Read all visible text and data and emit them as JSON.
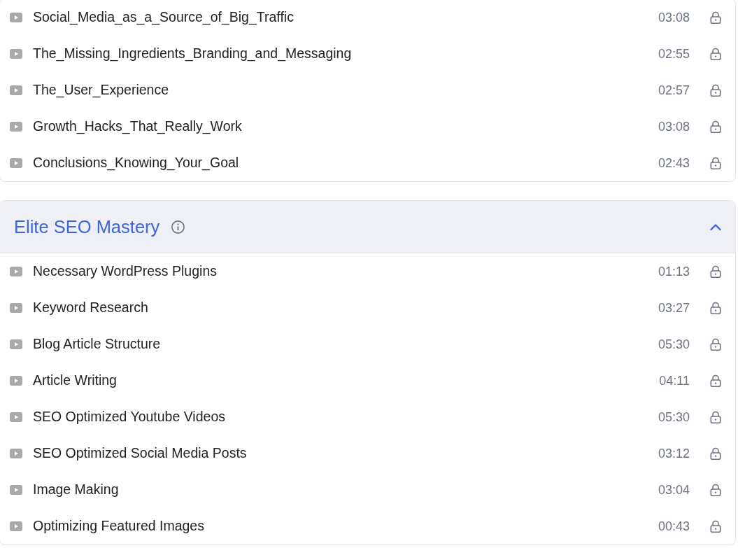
{
  "sections": [
    {
      "lessons": [
        {
          "title": "Social_Media_as_a_Source_of_Big_Traffic",
          "duration": "03:08",
          "locked": true
        },
        {
          "title": "The_Missing_Ingredients_Branding_and_Messaging",
          "duration": "02:55",
          "locked": true
        },
        {
          "title": "The_User_Experience",
          "duration": "02:57",
          "locked": true
        },
        {
          "title": "Growth_Hacks_That_Really_Work",
          "duration": "03:08",
          "locked": true
        },
        {
          "title": "Conclusions_Knowing_Your_Goal",
          "duration": "02:43",
          "locked": true
        }
      ]
    },
    {
      "title": "Elite SEO Mastery",
      "expanded": true,
      "lessons": [
        {
          "title": "Necessary WordPress Plugins",
          "duration": "01:13",
          "locked": true
        },
        {
          "title": "Keyword Research",
          "duration": "03:27",
          "locked": true
        },
        {
          "title": "Blog Article Structure",
          "duration": "05:30",
          "locked": true
        },
        {
          "title": "Article Writing",
          "duration": "04:11",
          "locked": true
        },
        {
          "title": "SEO Optimized Youtube Videos",
          "duration": "05:30",
          "locked": true
        },
        {
          "title": "SEO Optimized Social Media Posts",
          "duration": "03:12",
          "locked": true
        },
        {
          "title": "Image Making",
          "duration": "03:04",
          "locked": true
        },
        {
          "title": "Optimizing Featured Images",
          "duration": "00:43",
          "locked": true
        }
      ]
    }
  ]
}
